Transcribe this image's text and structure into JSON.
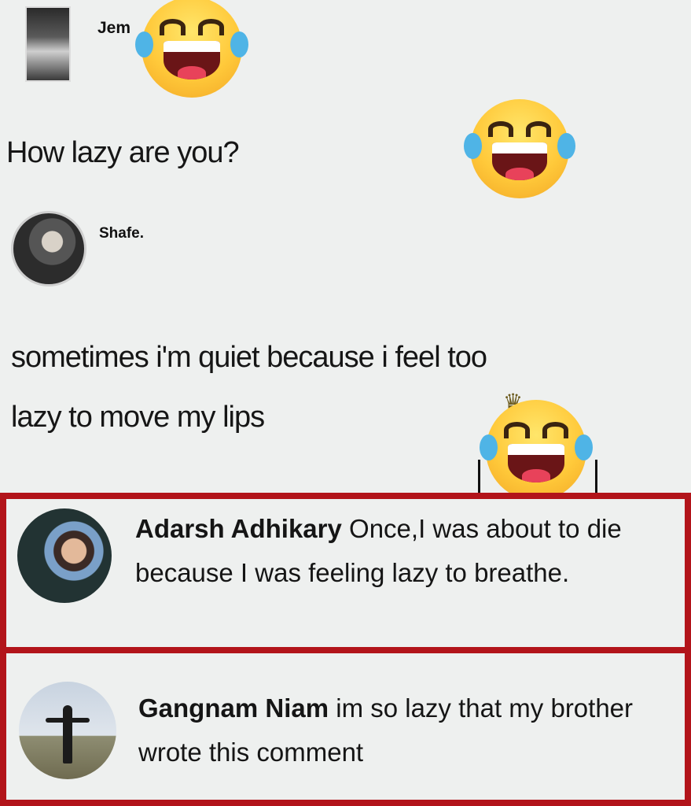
{
  "post": {
    "author": "Jem",
    "text": "How lazy are you?"
  },
  "reply": {
    "author": "Shafe.",
    "text_line1": "sometimes i'm quiet because i feel too",
    "text_line2": "lazy to move my lips"
  },
  "comments": [
    {
      "author": "Adarsh Adhikary",
      "text": "Once,I was about to die because I was feeling lazy to breathe."
    },
    {
      "author": "Gangnam Niam",
      "text": "im so lazy that my brother wrote this comment"
    }
  ],
  "colors": {
    "highlight_border": "#b2141a",
    "background": "#eef0ef",
    "emoji_face": "#ffc93a"
  },
  "icons": [
    "laughing-crying-emoji",
    "laughing-crying-emoji",
    "crowned-laughing-emoji"
  ]
}
